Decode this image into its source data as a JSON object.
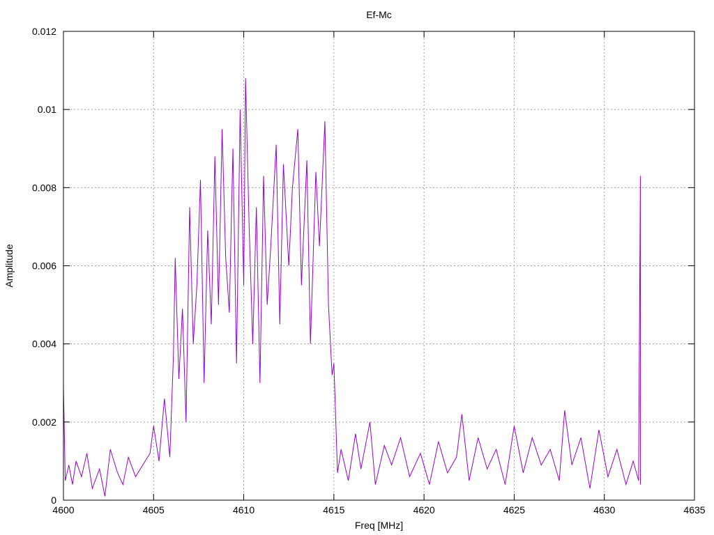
{
  "chart_data": {
    "type": "line",
    "title": "Ef-Mc",
    "xlabel": "Freq [MHz]",
    "ylabel": "Amplitude",
    "xlim": [
      4600,
      4635
    ],
    "ylim": [
      0,
      0.012
    ],
    "x_ticks": [
      4600,
      4605,
      4610,
      4615,
      4620,
      4625,
      4630,
      4635
    ],
    "x_tick_labels": [
      "4600",
      "4605",
      "4610",
      "4615",
      "4620",
      "4625",
      "4630",
      "4635"
    ],
    "y_ticks": [
      0,
      0.002,
      0.004,
      0.006,
      0.008,
      0.01,
      0.012
    ],
    "y_tick_labels": [
      "0",
      "0.002",
      "0.004",
      "0.006",
      "0.008",
      "0.01",
      "0.012"
    ],
    "grid": true,
    "grid_style": "dotted",
    "x_range_of_data": [
      4600,
      4632
    ],
    "series": [
      {
        "color": "#9400d3",
        "points": [
          [
            4600.0,
            0.0029
          ],
          [
            4600.1,
            0.0005
          ],
          [
            4600.3,
            0.0009
          ],
          [
            4600.5,
            0.0004
          ],
          [
            4600.7,
            0.001
          ],
          [
            4601.0,
            0.0006
          ],
          [
            4601.3,
            0.0012
          ],
          [
            4601.6,
            0.0003
          ],
          [
            4602.0,
            0.0008
          ],
          [
            4602.3,
            0.0001
          ],
          [
            4602.6,
            0.0013
          ],
          [
            4603.0,
            0.0007
          ],
          [
            4603.3,
            0.0004
          ],
          [
            4603.6,
            0.0011
          ],
          [
            4604.0,
            0.0006
          ],
          [
            4604.4,
            0.0009
          ],
          [
            4604.8,
            0.0012
          ],
          [
            4605.0,
            0.0019
          ],
          [
            4605.3,
            0.001
          ],
          [
            4605.6,
            0.0026
          ],
          [
            4605.9,
            0.0011
          ],
          [
            4606.1,
            0.0037
          ],
          [
            4606.2,
            0.0062
          ],
          [
            4606.4,
            0.0031
          ],
          [
            4606.6,
            0.0049
          ],
          [
            4606.8,
            0.002
          ],
          [
            4607.0,
            0.0075
          ],
          [
            4607.2,
            0.004
          ],
          [
            4607.4,
            0.0055
          ],
          [
            4607.6,
            0.0082
          ],
          [
            4607.8,
            0.003
          ],
          [
            4608.0,
            0.0069
          ],
          [
            4608.2,
            0.0045
          ],
          [
            4608.4,
            0.0088
          ],
          [
            4608.6,
            0.005
          ],
          [
            4608.8,
            0.0095
          ],
          [
            4609.0,
            0.0062
          ],
          [
            4609.2,
            0.0048
          ],
          [
            4609.4,
            0.009
          ],
          [
            4609.6,
            0.0035
          ],
          [
            4609.8,
            0.01
          ],
          [
            4610.0,
            0.0055
          ],
          [
            4610.1,
            0.0108
          ],
          [
            4610.3,
            0.007
          ],
          [
            4610.5,
            0.004
          ],
          [
            4610.7,
            0.0075
          ],
          [
            4610.9,
            0.003
          ],
          [
            4611.1,
            0.0083
          ],
          [
            4611.3,
            0.005
          ],
          [
            4611.5,
            0.0065
          ],
          [
            4611.8,
            0.0091
          ],
          [
            4612.0,
            0.0045
          ],
          [
            4612.2,
            0.0086
          ],
          [
            4612.5,
            0.006
          ],
          [
            4612.7,
            0.008
          ],
          [
            4613.0,
            0.0095
          ],
          [
            4613.2,
            0.0055
          ],
          [
            4613.5,
            0.0087
          ],
          [
            4613.7,
            0.004
          ],
          [
            4614.0,
            0.0084
          ],
          [
            4614.2,
            0.0065
          ],
          [
            4614.5,
            0.0097
          ],
          [
            4614.7,
            0.005
          ],
          [
            4614.9,
            0.0032
          ],
          [
            4615.0,
            0.0035
          ],
          [
            4615.2,
            0.0007
          ],
          [
            4615.4,
            0.0013
          ],
          [
            4615.8,
            0.0005
          ],
          [
            4616.2,
            0.0017
          ],
          [
            4616.5,
            0.0008
          ],
          [
            4617.0,
            0.002
          ],
          [
            4617.3,
            0.0004
          ],
          [
            4617.8,
            0.0014
          ],
          [
            4618.2,
            0.0009
          ],
          [
            4618.7,
            0.0016
          ],
          [
            4619.2,
            0.0006
          ],
          [
            4619.8,
            0.0012
          ],
          [
            4620.3,
            0.0004
          ],
          [
            4620.8,
            0.0015
          ],
          [
            4621.3,
            0.0007
          ],
          [
            4621.8,
            0.0011
          ],
          [
            4622.1,
            0.0022
          ],
          [
            4622.5,
            0.0005
          ],
          [
            4623.0,
            0.0016
          ],
          [
            4623.5,
            0.0008
          ],
          [
            4624.0,
            0.0013
          ],
          [
            4624.5,
            0.0004
          ],
          [
            4625.0,
            0.0019
          ],
          [
            4625.5,
            0.0007
          ],
          [
            4626.0,
            0.0016
          ],
          [
            4626.5,
            0.0009
          ],
          [
            4627.0,
            0.0013
          ],
          [
            4627.5,
            0.0005
          ],
          [
            4627.8,
            0.0023
          ],
          [
            4628.2,
            0.0009
          ],
          [
            4628.7,
            0.0016
          ],
          [
            4629.2,
            0.0003
          ],
          [
            4629.7,
            0.0018
          ],
          [
            4630.2,
            0.0006
          ],
          [
            4630.7,
            0.0013
          ],
          [
            4631.2,
            0.0004
          ],
          [
            4631.6,
            0.001
          ],
          [
            4631.9,
            0.0005
          ],
          [
            4632.0,
            0.0083
          ],
          [
            4632.0,
            0.0004
          ]
        ]
      }
    ]
  }
}
